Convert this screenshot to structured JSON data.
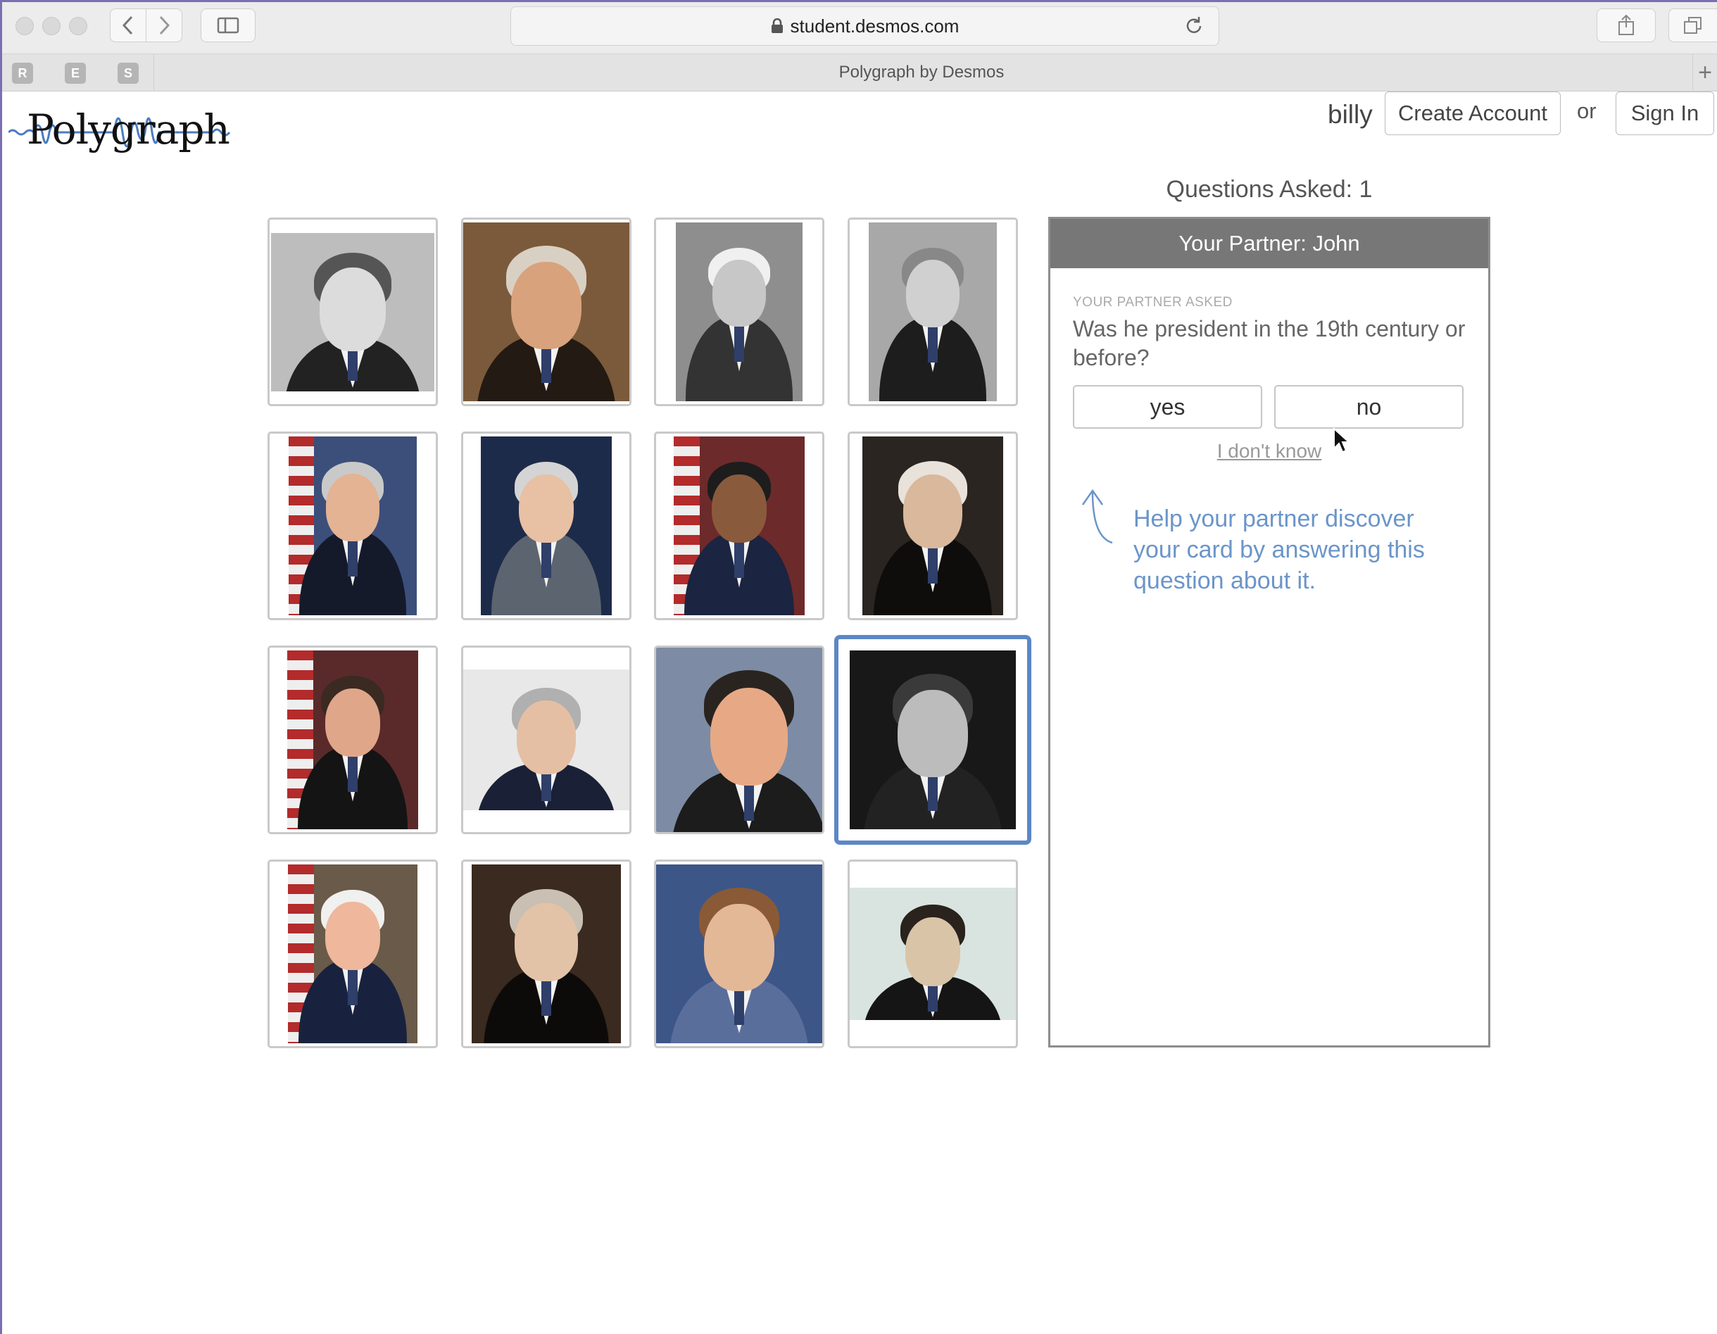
{
  "browser": {
    "url": "student.desmos.com",
    "tab_title": "Polygraph by Desmos",
    "favorites": [
      "R",
      "E",
      "S"
    ]
  },
  "header": {
    "logo": "Polygraph",
    "username": "billy",
    "create_account": "Create Account",
    "or": "or",
    "sign_in": "Sign In"
  },
  "game": {
    "questions_asked": "Questions Asked: 1",
    "partner_title": "Your Partner: John",
    "asked_label": "YOUR PARTNER ASKED",
    "question": "Was he president in the 19th century or before?",
    "yes": "yes",
    "no": "no",
    "dont_know": "I don't know",
    "help": "Help your partner discover your card by answering this question about it.",
    "selected_card": 11
  },
  "cards": [
    {
      "name": "portrait-bw-man-bowtie",
      "tone": "bw"
    },
    {
      "name": "portrait-painted-man-white-hair",
      "tone": "painting"
    },
    {
      "name": "portrait-engraving-man-white-hair",
      "tone": "engraving"
    },
    {
      "name": "portrait-bw-man-glasses",
      "tone": "bw"
    },
    {
      "name": "portrait-man-flag-background",
      "tone": "color"
    },
    {
      "name": "portrait-bald-man-suit",
      "tone": "color"
    },
    {
      "name": "portrait-man-arms-crossed-flags",
      "tone": "color"
    },
    {
      "name": "portrait-painted-man-dark-coat",
      "tone": "painting"
    },
    {
      "name": "portrait-man-flag-smiling",
      "tone": "color"
    },
    {
      "name": "portrait-man-stamp",
      "tone": "stamp"
    },
    {
      "name": "portrait-man-dark-hair",
      "tone": "color"
    },
    {
      "name": "portrait-bw-man-mustache",
      "tone": "bw"
    },
    {
      "name": "portrait-man-blonde-flag",
      "tone": "color"
    },
    {
      "name": "portrait-painted-man-powdered-hair",
      "tone": "painting"
    },
    {
      "name": "portrait-painted-man-blue-background",
      "tone": "painting"
    },
    {
      "name": "portrait-man-beard",
      "tone": "engraving"
    }
  ]
}
